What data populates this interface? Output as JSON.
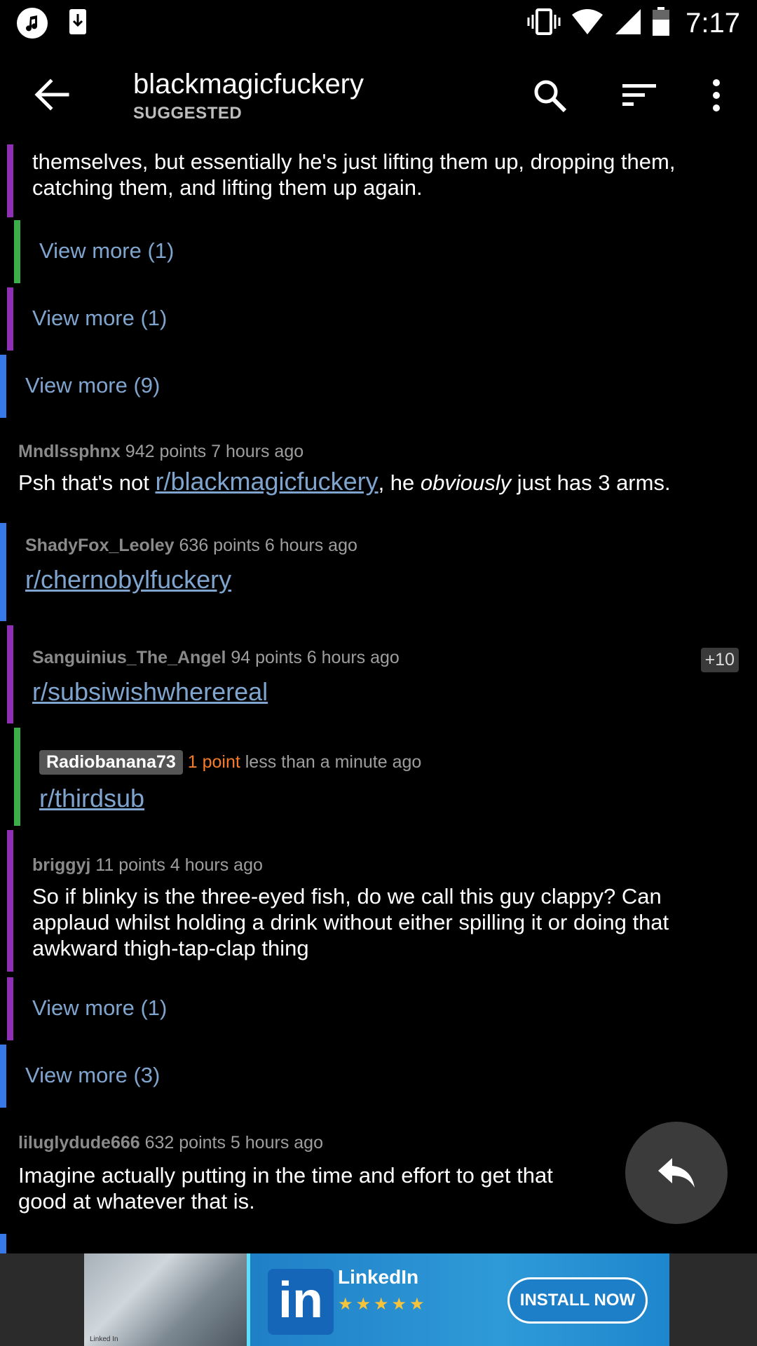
{
  "status_bar": {
    "time": "7:17",
    "icons": [
      "music-note-icon",
      "download-icon",
      "vibrate-icon",
      "wifi-icon",
      "signal-icon",
      "battery-icon"
    ]
  },
  "app_bar": {
    "title": "blackmagicfuckery",
    "subtitle": "SUGGESTED",
    "icons": [
      "back-arrow-icon",
      "search-icon",
      "sort-icon",
      "more-vert-icon"
    ]
  },
  "comments": {
    "partial": {
      "text": "themselves, but essentially he's just lifting them up, dropping them, catching them, and lifting them up again."
    },
    "view_more_1": "View more (1)",
    "view_more_2": "View more (1)",
    "view_more_3": "View more (9)",
    "c1": {
      "author": "Mndlssphnx",
      "meta": " 942 points 7 hours ago",
      "text_before": "Psh that's not ",
      "link": "r/blackmagicfuckery",
      "text_mid": ", he ",
      "text_italic": "obviously",
      "text_after": " just has 3 arms."
    },
    "c2": {
      "author": "ShadyFox_Leoley",
      "meta": " 636 points 6 hours ago",
      "link": "r/chernobylfuckery"
    },
    "c3": {
      "author": "Sanguinius_The_Angel",
      "meta": " 94 points 6 hours ago",
      "link": "r/subsiwishwherereal",
      "badge": "+10"
    },
    "c4": {
      "author": "Radiobanana73",
      "points": "1 point",
      "meta": " less than a minute ago",
      "link": "r/thirdsub"
    },
    "c5": {
      "author": "briggyj",
      "meta": " 11 points 4 hours ago",
      "text": "So if blinky is the three-eyed fish, do we call this guy clappy? Can applaud whilst holding a drink without either spilling it or doing that awkward thigh-tap-clap thing"
    },
    "view_more_4": "View more (1)",
    "view_more_5": "View more (3)",
    "c6": {
      "author": "liluglydude666",
      "meta": " 632 points 5 hours ago",
      "text": "Imagine actually putting in the time and effort to get that good at whatever that is."
    }
  },
  "fab": {
    "icon": "reply-icon"
  },
  "ad": {
    "logo": "in",
    "brand": "LinkedIn",
    "stars": "★★★★★",
    "cta": "INSTALL NOW",
    "caption": "Linked In"
  },
  "colors": {
    "depth_purple": "#8e2fb5",
    "depth_green": "#3cae49",
    "depth_blue": "#3779e8",
    "link": "#7fa5cf",
    "accent_orange": "#f57c2a"
  }
}
